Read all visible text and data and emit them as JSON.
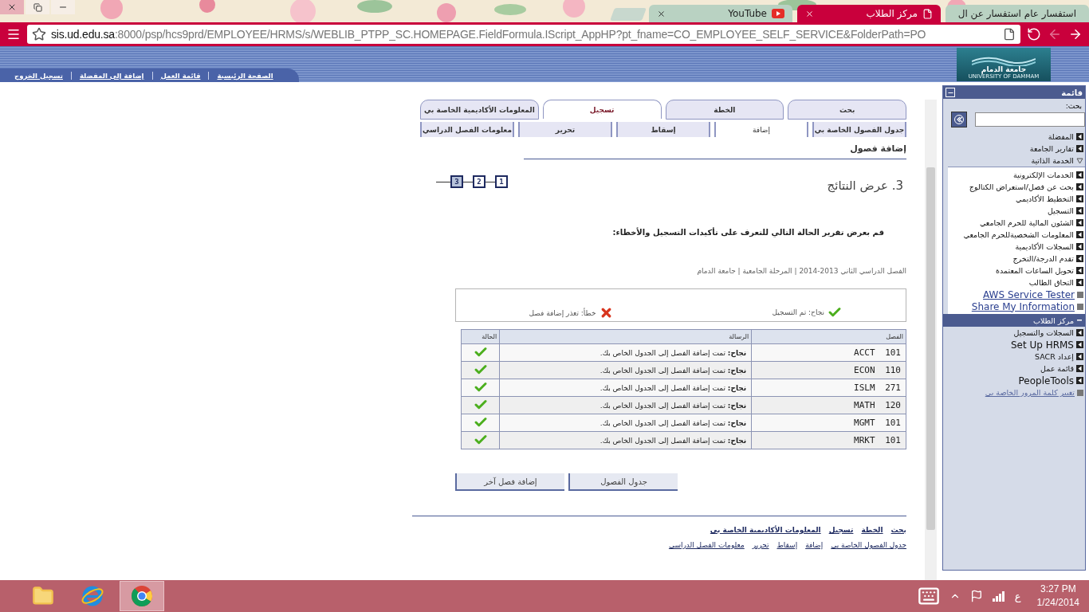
{
  "browser": {
    "tabs": [
      {
        "kind": "page",
        "title": "استفسار عام استفسار عن ال",
        "selected": false
      },
      {
        "kind": "page",
        "title": "مركز الطلاب",
        "selected": true
      },
      {
        "kind": "video",
        "title": "YouTube",
        "selected": false
      }
    ],
    "address": {
      "host": "sis.ud.edu.sa",
      "path": ":8000/psp/hcs9prd/EMPLOYEE/HRMS/s/WEBLIB_PTPP_SC.HOMEPAGE.FieldFormula.IScript_AppHP?pt_fname=CO_EMPLOYEE_SELF_SERVICE&FolderPath=PO"
    },
    "back_enabled": true,
    "forward_enabled": false
  },
  "header": {
    "nav_links": [
      "الصفحة الرئيسية",
      "قائمة العمل",
      "إضافة إلى المفضلة",
      "تسجيل الخروج"
    ],
    "logo": {
      "name": "جامعة الدمام",
      "subtitle": "UNIVERSITY OF DAMMAM"
    }
  },
  "page": {
    "tabs": [
      {
        "label": "بحث",
        "selected": false
      },
      {
        "label": "الخطة",
        "selected": false
      },
      {
        "label": "تسجيل",
        "selected": true
      },
      {
        "label": "المعلومات الأكاديمية الخاصة بي",
        "selected": false
      }
    ],
    "subtabs": [
      {
        "label": "جدول الفصول الخاصة بي",
        "selected": false
      },
      {
        "label": "إضافة",
        "selected": true
      },
      {
        "label": "إسقاط",
        "selected": false
      },
      {
        "label": "تحرير",
        "selected": false
      },
      {
        "label": "معلومات الفصل الدراسي",
        "selected": false
      }
    ],
    "title": "إضافة فصول",
    "step_title": "3. عرض النتائج",
    "steps": [
      {
        "label": "1",
        "selected": false
      },
      {
        "label": "2",
        "selected": false
      },
      {
        "label": "3",
        "selected": true
      }
    ],
    "instruction": "قم بعرض تقرير الحالة التالي للتعرف على تأكيدات التسجيل والأخطاء:",
    "term": "الفصل الدراسي الثاني 2013-2014 | المرحلة الجامعية | جامعة الدمام",
    "legend": [
      {
        "kind": "success",
        "label": "نجاح: تم التسجيل"
      },
      {
        "kind": "error",
        "label": "خطأ: تعذر إضافة فصل"
      }
    ],
    "table": {
      "columns": [
        "الفصل",
        "الرسالة",
        "الحالة"
      ],
      "rows": [
        {
          "class": "ACCT 101",
          "message": "**نجاح:** تمت إضافة الفصل إلى الجدول الخاص بك.",
          "success": true
        },
        {
          "class": "ECON 110",
          "message": "**نجاح:** تمت إضافة الفصل إلى الجدول الخاص بك.",
          "success": true
        },
        {
          "class": "ISLM 271",
          "message": "**نجاح:** تمت إضافة الفصل إلى الجدول الخاص بك.",
          "success": true
        },
        {
          "class": "MATH 120",
          "message": "**نجاح:** تمت إضافة الفصل إلى الجدول الخاص بك.",
          "success": true
        },
        {
          "class": "MGMT 101",
          "message": "**نجاح:** تمت إضافة الفصل إلى الجدول الخاص بك.",
          "success": true
        },
        {
          "class": "MRKT 101",
          "message": "**نجاح:** تمت إضافة الفصل إلى الجدول الخاص بك.",
          "success": true
        }
      ]
    },
    "buttons": [
      "جدول الفصول",
      "إضافة فصل آخر"
    ],
    "footer_links": [
      "بحث",
      "الخطة",
      "تسجيل",
      "المعلومات الأكاديمية الخاصة بي"
    ],
    "footer_sublinks": [
      "جدول الفصول الخاصة بي",
      "إضافة",
      "إسقاط",
      "تحرير",
      "معلومات الفصل الدراسي"
    ]
  },
  "sidebar": {
    "title": "قائمة",
    "search_label": "بحث:",
    "items": [
      {
        "kind": "folder",
        "label": "المفضلة",
        "expanded": false
      },
      {
        "kind": "folder",
        "label": "تقارير الجامعة",
        "expanded": false
      },
      {
        "kind": "folder",
        "label": "الخدمة الذاتية",
        "expanded": true,
        "children": [
          {
            "kind": "folder",
            "label": "الخدمات الإلكترونية",
            "expanded": false
          },
          {
            "kind": "folder",
            "label": "بحث عن فصل/استعراض الكتالوج",
            "expanded": false
          },
          {
            "kind": "folder",
            "label": "التخطيط الأكاديمي",
            "expanded": false
          },
          {
            "kind": "folder",
            "label": "التسجيل",
            "expanded": false
          },
          {
            "kind": "folder",
            "label": "الشئون المالية للحرم الجامعي",
            "expanded": false
          },
          {
            "kind": "folder",
            "label": "المعلومات الشخصيةللحرم الجامعي",
            "expanded": false
          },
          {
            "kind": "folder",
            "label": "السجلات الأكاديمية",
            "expanded": false
          },
          {
            "kind": "folder",
            "label": "تقدم الدرجة/التخرج",
            "expanded": false
          },
          {
            "kind": "folder",
            "label": "تحويل الساعات المعتمدة",
            "expanded": false
          },
          {
            "kind": "folder",
            "label": "التحاق الطالب",
            "expanded": false
          },
          {
            "kind": "link",
            "label": "AWS Service Tester"
          },
          {
            "kind": "link",
            "label": "Share My Information"
          }
        ]
      },
      {
        "kind": "current",
        "label": "مركز الطلاب",
        "selected": true
      },
      {
        "kind": "folder",
        "label": "السجلات والتسجيل",
        "expanded": false
      },
      {
        "kind": "folder",
        "label": "Set Up HRMS",
        "expanded": false
      },
      {
        "kind": "folder",
        "label": "إعداد SACR",
        "expanded": false
      },
      {
        "kind": "folder",
        "label": "قائمة عمل",
        "expanded": false
      },
      {
        "kind": "folder",
        "label": "PeopleTools",
        "expanded": false
      },
      {
        "kind": "link",
        "label": "تغيير كلمة المرور الخاصة بي"
      }
    ]
  },
  "taskbar": {
    "apps": [
      {
        "kind": "explorer",
        "active": false
      },
      {
        "kind": "ie",
        "active": false
      },
      {
        "kind": "chrome",
        "active": true
      }
    ],
    "language": "ع",
    "time": "3:27 PM",
    "date": "1/24/2014"
  }
}
